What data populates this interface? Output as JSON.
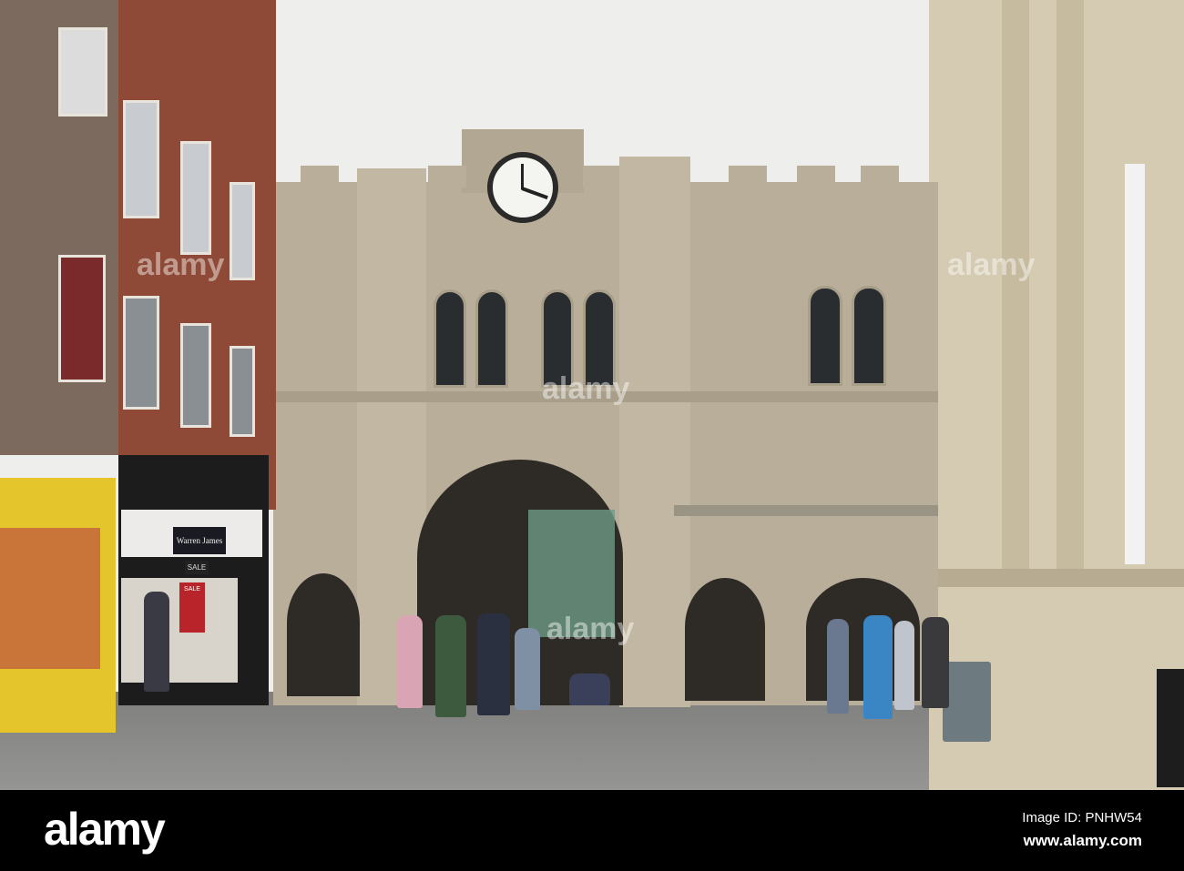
{
  "shop_sign": {
    "brand": "Warren James",
    "sale_top": "SALE",
    "sale_window": "SALE"
  },
  "watermark": {
    "logo": "alamy",
    "image_id": "Image ID: PNHW54",
    "url": "www.alamy.com"
  },
  "colors": {
    "sky": "#eeeeec",
    "stone": "#b9ae9a",
    "brick": "#8e4a36",
    "shop_yellow": "#e4c52c",
    "pavement": "#8c8c8a"
  }
}
